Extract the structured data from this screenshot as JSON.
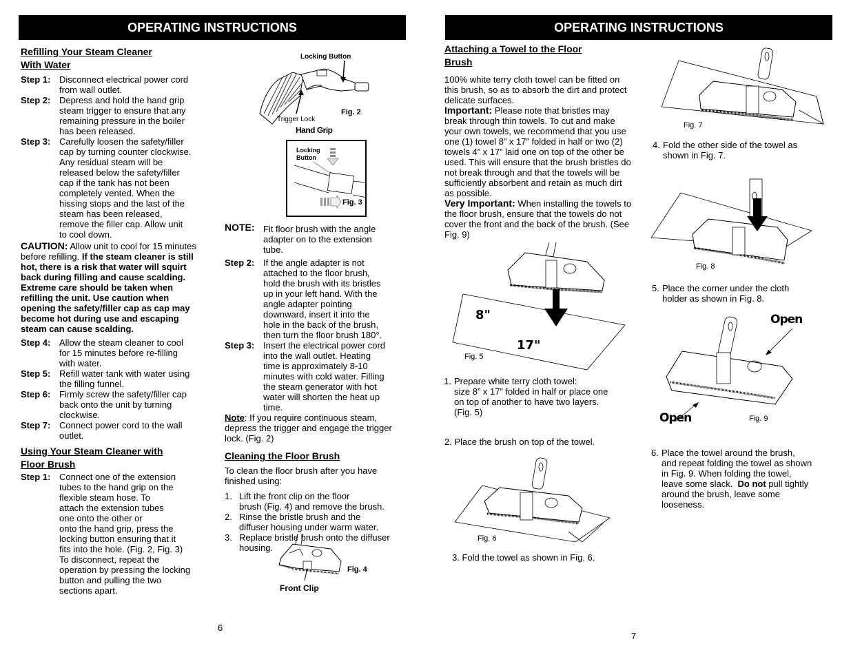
{
  "pages": [
    {
      "header": "OPERATING INSTRUCTIONS",
      "page_number": "6",
      "col1": {
        "section1_title_line1": "Refilling Your Steam Cleaner",
        "section1_title_line2": "With Water",
        "steps_a": [
          {
            "label": "Step 1:",
            "lines": [
              "Disconnect electrical power cord",
              "from wall outlet."
            ]
          },
          {
            "label": "Step 2:",
            "lines": [
              "Depress and hold the hand grip",
              "steam trigger to ensure that any",
              "remaining pressure in the boiler",
              "has been released."
            ]
          },
          {
            "label": "Step 3:",
            "lines": [
              "Carefully loosen the safety/filler",
              "cap by turning counter clockwise.",
              "Any residual steam will be",
              "released below the safety/filler",
              "cap if the tank has not been",
              "completely vented.  When the",
              "hissing stops and the last of  the",
              "steam has been released,",
              "remove the filler cap.  Allow unit",
              "to cool down."
            ]
          }
        ],
        "caution": {
          "label": "CAUTION:",
          "normal": " Allow unit to cool for 15 minutes before refilling. ",
          "bold": "If the steam cleaner is still hot, there is a risk that water will squirt back during filling and cause scalding.  Extreme care should be taken when refilling the unit. Use caution when opening the safety/filler cap as cap may become hot during use and escaping steam can cause scalding."
        },
        "steps_b": [
          {
            "label": "Step 4:",
            "lines": [
              "Allow  the steam cleaner to cool",
              "for 15 minutes before re-filling",
              "with water."
            ]
          },
          {
            "label": "Step 5:",
            "lines": [
              "Refill water tank with water using",
              "the filling funnel."
            ]
          },
          {
            "label": "Step 6:",
            "lines": [
              "Firmly screw  the safety/filler cap",
              "back onto the unit by turning",
              "clockwise."
            ]
          },
          {
            "label": "Step 7:",
            "lines": [
              "Connect power cord to the wall",
              "outlet."
            ]
          }
        ],
        "section2_title_line1": "Using Your Steam Cleaner with",
        "section2_title_line2": "Floor Brush",
        "steps_c": [
          {
            "label": "Step 1:",
            "lines": [
              "Connect one of the extension",
              "tubes to the hand grip on the",
              "flexible steam hose.  To",
              "attach the extension tubes",
              "one onto the other or",
              "onto the hand grip, press the",
              "locking button ensuring that it",
              "fits into the hole. (Fig. 2, Fig. 3)",
              "To disconnect, repeat the",
              "operation by pressing the locking",
              "button and pulling the two",
              "sections apart."
            ]
          }
        ]
      },
      "col2": {
        "fig2": {
          "locking_button": "Locking Button",
          "trigger_lock": "Trigger Lock",
          "caption": "Fig. 2",
          "title": "Hand Grip"
        },
        "fig3": {
          "locking_button_line1": "Locking",
          "locking_button_line2": "Button",
          "caption": "Fig. 3"
        },
        "note": {
          "label": "NOTE:",
          "lines": [
            "Fit floor brush with the angle",
            "adapter  on to the extension",
            "tube."
          ]
        },
        "steps": [
          {
            "label": "Step 2:",
            "lines": [
              "If the angle adapter is not",
              "attached to the floor brush,",
              "hold the brush with its bristles",
              "up in your left hand. With the",
              "angle adapter pointing",
              "downward, insert it into the",
              "hole in the back of the brush,",
              "then turn the floor brush 180°."
            ]
          },
          {
            "label": "Step 3:",
            "lines": [
              "Insert the electrical power cord",
              "into the wall outlet. Heating",
              "time is approximately 8-10",
              "minutes with cold water. Filling",
              "the steam generator with hot",
              "water will shorten the heat up",
              "time."
            ]
          }
        ],
        "note2": {
          "label": "Note",
          "text": ": If you require continuous steam, depress the trigger and engage the trigger lock. (Fig. 2)"
        },
        "cleaning_title": "Cleaning the Floor Brush",
        "cleaning_intro": "To clean the floor brush after you have finished using:",
        "cleaning_items": [
          {
            "n": "1.",
            "lines": [
              "Lift the front clip on the floor",
              "brush (Fig. 4) and remove the brush."
            ]
          },
          {
            "n": "2.",
            "lines": [
              "Rinse the bristle brush and the",
              "diffuser housing under warm water."
            ]
          },
          {
            "n": "3.",
            "lines": [
              "Replace bristle brush onto the diffuser",
              "housing."
            ]
          }
        ],
        "fig4": {
          "caption": "Fig. 4",
          "front_clip": "Front  Clip"
        }
      }
    },
    {
      "header": "OPERATING INSTRUCTIONS",
      "page_number": "7",
      "col1": {
        "title_line1": "Attaching a Towel to the Floor",
        "title_line2": "Brush",
        "intro": "100% white terry cloth towel can be fitted on this brush, so as to absorb the dirt and protect delicate surfaces.",
        "important_label": "Important:",
        "important_text": "  Please note that bristles may break through thin towels. To cut and make your own towels, we recommend that you use one (1) towel 8” x 17” folded in half or two (2) towels 4” x 17” laid one on top of the other be used. This will ensure that the brush bristles do not break through and that the towels will be sufficiently absorbent and retain as much dirt as possible.",
        "very_important_label": "Very Important:",
        "very_important_text": " When installing the towels to the floor brush, ensure that the towels do not cover the front and the back of the brush. (See Fig. 9)",
        "fig5": {
          "caption": "Fig. 5",
          "width_label": "8\"",
          "length_label": "17\""
        },
        "item1": {
          "n": "1.",
          "lines": [
            "Prepare white terry cloth towel:",
            "size 8” x 17”  folded in half or place one",
            "on top of another to have two layers.",
            "(Fig. 5)"
          ]
        },
        "item2": "2. Place the brush on top of the towel.",
        "fig6": {
          "caption": "Fig. 6"
        },
        "item3": "3. Fold the towel as shown in Fig. 6."
      },
      "col2": {
        "fig7": {
          "caption": "Fig. 7"
        },
        "item4": {
          "n": "4.",
          "lines": [
            "Fold the other side of the towel as",
            "shown in Fig. 7."
          ]
        },
        "fig8": {
          "caption": "Fig. 8"
        },
        "item5": {
          "n": "5.",
          "lines": [
            "Place the corner under the cloth",
            "holder as shown in Fig. 8."
          ]
        },
        "fig9": {
          "caption": "Fig. 9",
          "open_top": "Open",
          "open_bottom": "Open"
        },
        "item6": {
          "n": "6.",
          "line1": "Place the towel around the brush,",
          "line2": "and repeat folding the towel as shown",
          "line3": "in Fig. 9.  When folding the towel,",
          "line4_pre": "leave some slack.  ",
          "line4_bold": "Do not",
          "line4_post": " pull tightly",
          "line5": "around the brush, leave some",
          "line6": "looseness."
        }
      }
    }
  ]
}
